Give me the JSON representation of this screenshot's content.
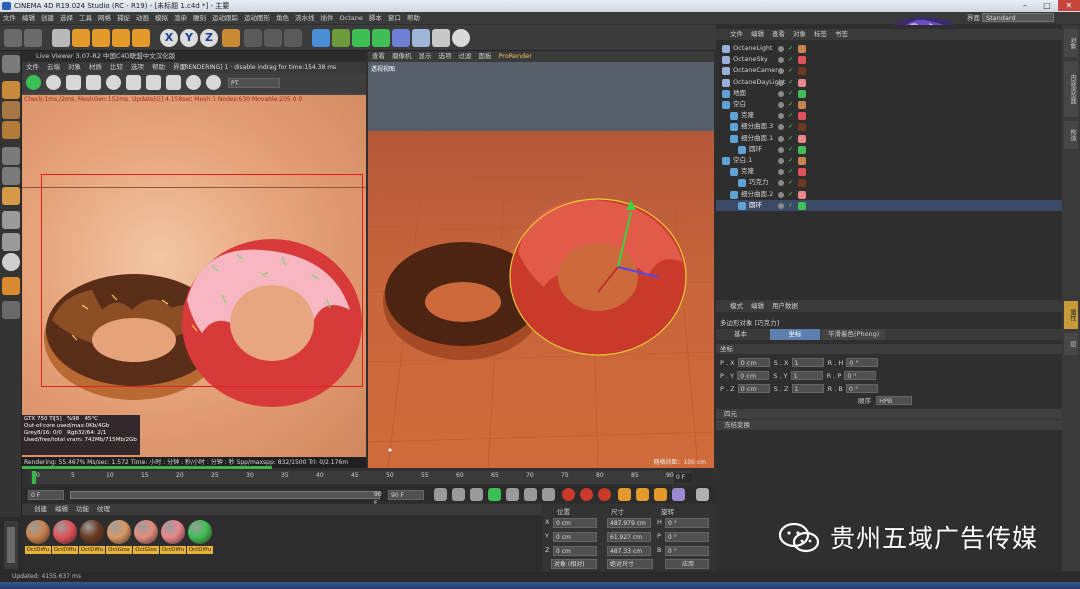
{
  "app": {
    "title": "CINEMA 4D R19.024 Studio (RC - R19) - [未标题 1.c4d *] - 主要",
    "menus": [
      "文件",
      "编辑",
      "创建",
      "选择",
      "工具",
      "网格",
      "捕捉",
      "动画",
      "模拟",
      "渲染",
      "雕刻",
      "运动跟踪",
      "运动图形",
      "角色",
      "流水线",
      "插件",
      "Octane",
      "脚本",
      "窗口",
      "帮助"
    ],
    "layout_label": "界面",
    "layout_value": "Standard",
    "status": "Updated: 4155.637 ms"
  },
  "toolbar": {
    "axis_labels": [
      "X",
      "Y",
      "Z"
    ]
  },
  "live_viewer": {
    "title": "Live Viewer 3.07-R2 中国C4D联盟中文汉化版",
    "menus": [
      "文件",
      "云端",
      "对象",
      "材质",
      "比较",
      "选项",
      "帮助",
      "界面"
    ],
    "status": "[RENDERING] 1 · disable indrag for time:154.38 ms",
    "camera_select": "PT",
    "check_line": "Check:1ms./2ms. MeshGen:152ms. Update[G]:4.158sec Mesh:1 Nodes:630 Movable:205  0 0",
    "hud": {
      "gpu": "GTX 750 Ti[5]",
      "gpu_percent": "%98",
      "gpu_temp": "45°C",
      "out_of_core": "Out-of-core used/max:0Kb/4Gb",
      "grey": "Grey8/16: 0/0",
      "rgb": "Rgb32/64: 2/1",
      "vram": "Used/free/total vram: 742Mb/715Mb/2Gb"
    },
    "footer": "Rendering: 55.467%   Ms/sec: 1.572   Time: 小时 : 分钟 : 秒/小时 : 分钟 : 秒   Spp/maxspp: 832/1500   Tri: 0/2.176m  Mesh: 205"
  },
  "viewport": {
    "menus": [
      "查看",
      "摄像机",
      "显示",
      "选项",
      "过滤",
      "面板",
      "ProRender"
    ],
    "view_label": "透视视图",
    "grid_scale": "网格间距：100 cm"
  },
  "timeline": {
    "ticks": [
      "0",
      "5",
      "10",
      "15",
      "20",
      "25",
      "30",
      "35",
      "40",
      "45",
      "50",
      "55",
      "60",
      "65",
      "70",
      "75",
      "80",
      "85",
      "90"
    ],
    "end_frame": "0 F",
    "start_field": "0 F",
    "end_field": "90 F",
    "range_end": "90 F",
    "current": "0"
  },
  "materials": {
    "tabs": [
      "创建",
      "编辑",
      "功能",
      "纹理"
    ],
    "items": [
      {
        "label": "OctDiffu",
        "color": "#c9834f"
      },
      {
        "label": "OctDiffu",
        "color": "#e0525a"
      },
      {
        "label": "OctDiffu",
        "color": "#6a3b22"
      },
      {
        "label": "OctGlos",
        "color": "#d99966"
      },
      {
        "label": "OctGlos",
        "color": "#e48c80"
      },
      {
        "label": "OctDiffu",
        "color": "#e8868c"
      },
      {
        "label": "OctDiffu",
        "color": "#3fbf55"
      }
    ]
  },
  "coords": {
    "headers": [
      "位置",
      "尺寸",
      "旋转"
    ],
    "rows": [
      {
        "axis": "X",
        "pos": "0 cm",
        "size": "487.979 cm",
        "rot_label": "H",
        "rot": "0 °"
      },
      {
        "axis": "Y",
        "pos": "0 cm",
        "size": "61.927 cm",
        "rot_label": "P",
        "rot": "0 °"
      },
      {
        "axis": "Z",
        "pos": "0 cm",
        "size": "487.33 cm",
        "rot_label": "B",
        "rot": "0 °"
      }
    ],
    "mode": "对象 (相对)",
    "size_mode": "绝对尺寸",
    "apply": "应用"
  },
  "object_manager": {
    "tabs": [
      "文件",
      "编辑",
      "查看",
      "对象",
      "标签",
      "书签"
    ],
    "objects": [
      {
        "name": "OctaneLight",
        "indent": 0,
        "selected": false
      },
      {
        "name": "OctaneSky",
        "indent": 0,
        "selected": false
      },
      {
        "name": "OctaneCamera",
        "indent": 0,
        "selected": false
      },
      {
        "name": "OctaneDayLight",
        "indent": 0,
        "selected": false
      },
      {
        "name": "地面",
        "indent": 0,
        "selected": false
      },
      {
        "name": "空白",
        "indent": 0,
        "selected": false
      },
      {
        "name": "克隆",
        "indent": 1,
        "selected": false
      },
      {
        "name": "细分曲面.3",
        "indent": 1,
        "selected": false
      },
      {
        "name": "细分曲面.1",
        "indent": 1,
        "selected": false
      },
      {
        "name": "圆环",
        "indent": 2,
        "selected": false
      },
      {
        "name": "空白.1",
        "indent": 0,
        "selected": false
      },
      {
        "name": "克隆",
        "indent": 1,
        "selected": false
      },
      {
        "name": "巧克力",
        "indent": 2,
        "selected": false
      },
      {
        "name": "细分曲面.2",
        "indent": 1,
        "selected": false
      },
      {
        "name": "圆环",
        "indent": 2,
        "selected": true
      }
    ]
  },
  "attributes": {
    "tabs": [
      "模式",
      "编辑",
      "用户数据"
    ],
    "title": "多边形对象 [巧克力]",
    "subtabs": [
      "基本",
      "坐标",
      "平滑着色(Phong)"
    ],
    "active_subtab": 1,
    "section": "坐标",
    "rows": [
      {
        "a": "P . X",
        "av": "0 cm",
        "b": "S . X",
        "bv": "1",
        "c": "R . H",
        "cv": "0 °"
      },
      {
        "a": "P . Y",
        "av": "0 cm",
        "b": "S . Y",
        "bv": "1",
        "c": "R . P",
        "cv": "0 °"
      },
      {
        "a": "P . Z",
        "av": "0 cm",
        "b": "S . Z",
        "bv": "1",
        "c": "R . B",
        "cv": "0 °"
      }
    ],
    "order_label": "顺序",
    "order_value": "HPB",
    "sections": [
      "四元",
      "冻结变换"
    ]
  },
  "right_strip": [
    "对象",
    "内容浏览器",
    "构造",
    "属性",
    "层"
  ],
  "watermark": "贵州五域广告传媒",
  "colors": {
    "accent_blue": "#5d7fb0",
    "selection": "#3d4a66",
    "render_red_box": "#e02020",
    "progress_green": "#3bb54a"
  }
}
